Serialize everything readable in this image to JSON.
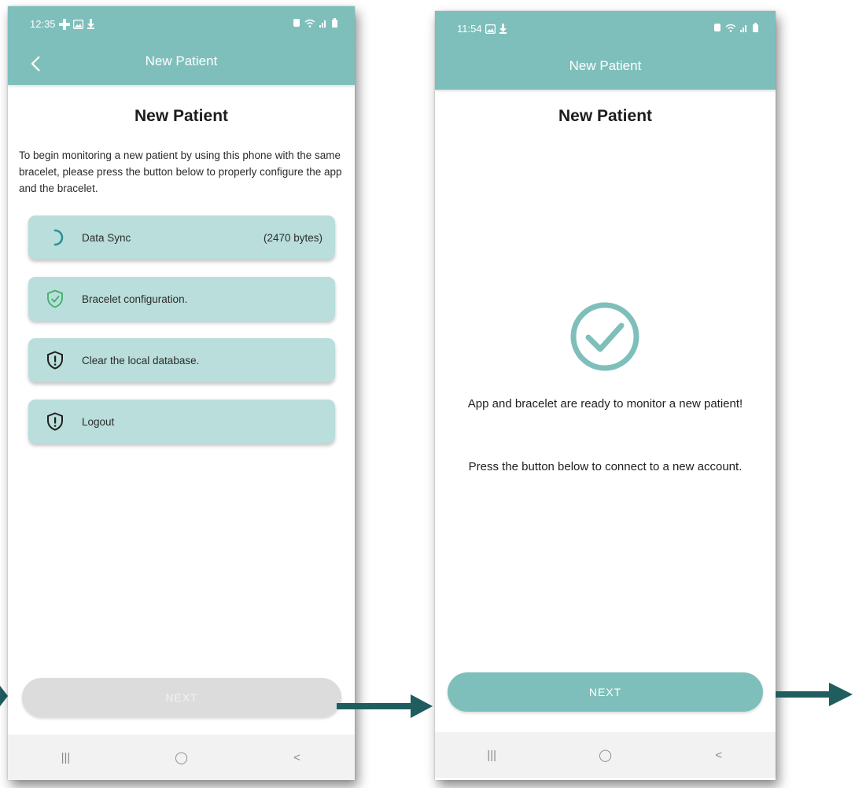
{
  "colors": {
    "teal": "#7fbfbb",
    "step_bg": "#b9dedb",
    "arrow": "#1f5d5f",
    "disabled_button": "#dcdcdc"
  },
  "screen_a": {
    "status_time": "12:35",
    "status_icons_left": [
      "plus-icon",
      "image-icon",
      "download-icon"
    ],
    "status_icons_right": [
      "alarm-icon",
      "wifi-icon",
      "signal-icon",
      "battery-icon"
    ],
    "appbar_title": "New Patient",
    "heading": "New Patient",
    "intro": "To begin monitoring a new patient by using this phone with the same bracelet, please press the button below to properly configure the app and the bracelet.",
    "steps": [
      {
        "label": "Data Sync",
        "detail": "(2470 bytes)",
        "icon": "loading-spinner-icon"
      },
      {
        "label": "Bracelet configuration.",
        "icon": "shield-check-icon"
      },
      {
        "label": "Clear the local database.",
        "icon": "shield-alert-icon"
      },
      {
        "label": "Logout",
        "icon": "shield-alert-icon"
      }
    ],
    "next_label": "NEXT",
    "next_enabled": false
  },
  "screen_b": {
    "status_time": "11:54",
    "status_icons_left": [
      "image-icon",
      "download-icon"
    ],
    "status_icons_right": [
      "alarm-icon",
      "wifi-icon",
      "signal-icon",
      "battery-icon"
    ],
    "appbar_title": "New Patient",
    "heading": "New Patient",
    "message_1": "App and bracelet are ready to monitor a new patient!",
    "message_2": "Press the button below to connect to a new account.",
    "next_label": "NEXT",
    "next_enabled": true
  },
  "navbar": {
    "recent": "|||",
    "home": "◯",
    "back": "<"
  }
}
